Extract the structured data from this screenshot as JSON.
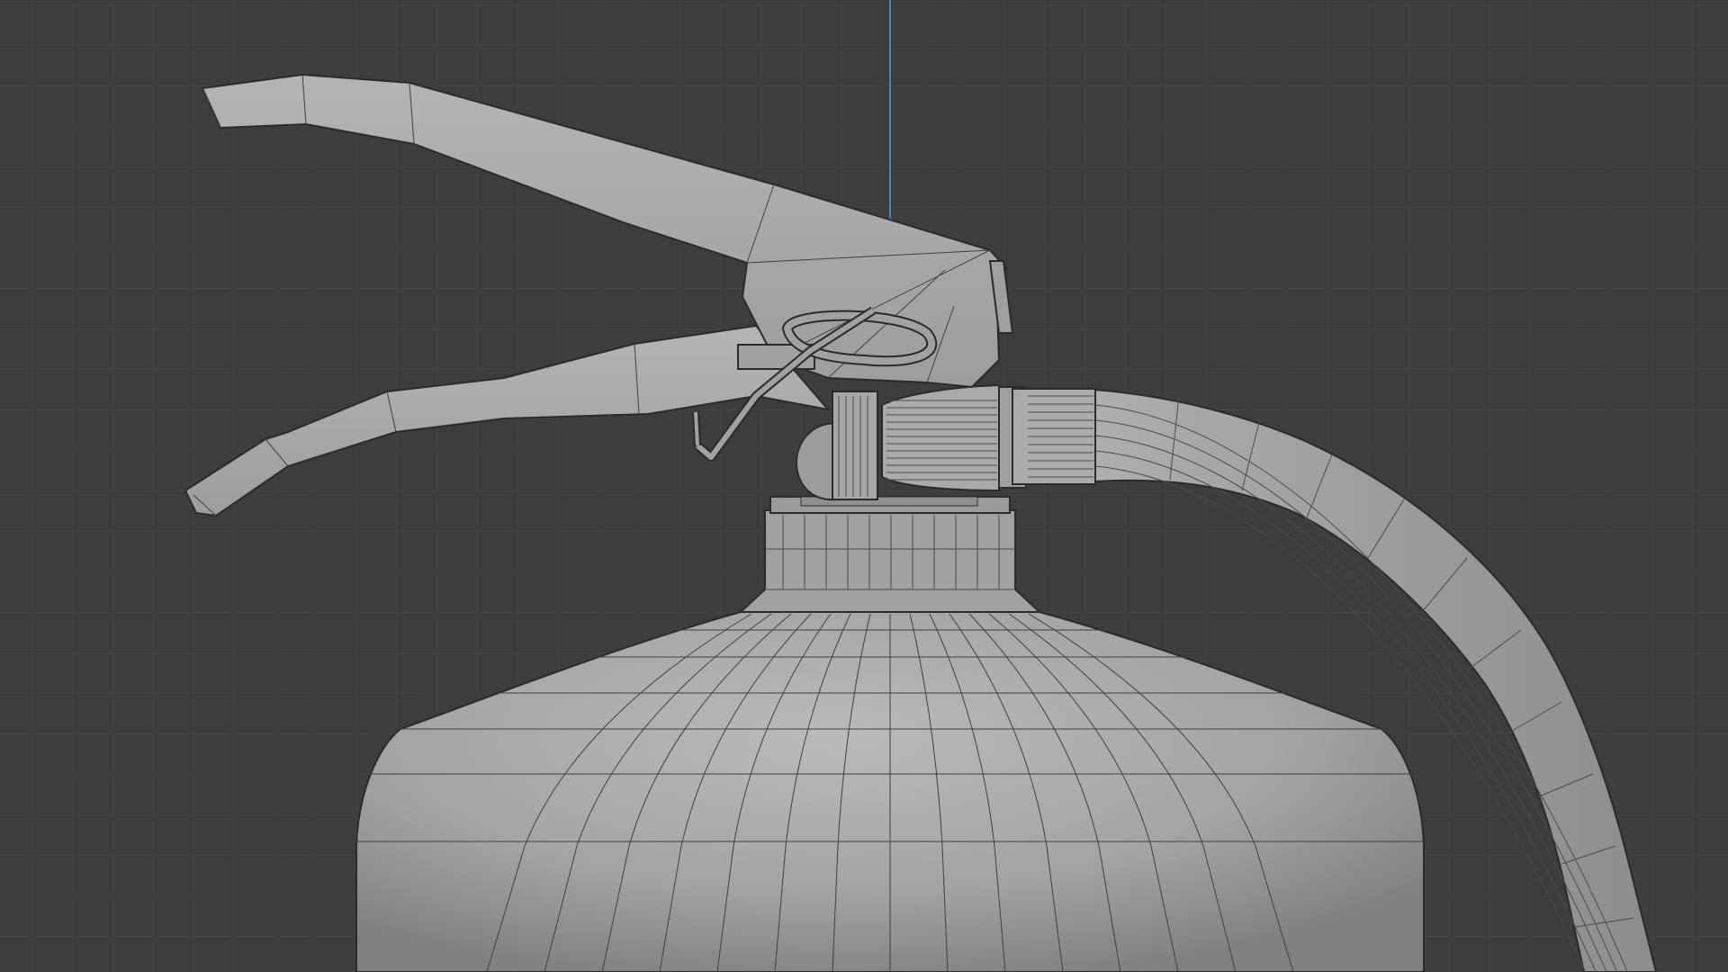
{
  "viewport": {
    "background_color": "#3d3d3d",
    "grid_minor_color": "#474747",
    "grid_major_color": "#4f4f4f",
    "z_axis_color": "#4d7fc2",
    "mesh_fill_color": "#a8aaa9",
    "mesh_shade_color": "#8d8f8e",
    "wire_color": "#2b2b2b",
    "shading_mode": "solid-with-wireframe-overlay"
  },
  "object": {
    "kind": "fire-extinguisher",
    "parts": [
      "cylinder-body",
      "neck-collar",
      "valve-head",
      "top-lever",
      "bottom-handle",
      "safety-pin",
      "discharge-hose"
    ]
  }
}
